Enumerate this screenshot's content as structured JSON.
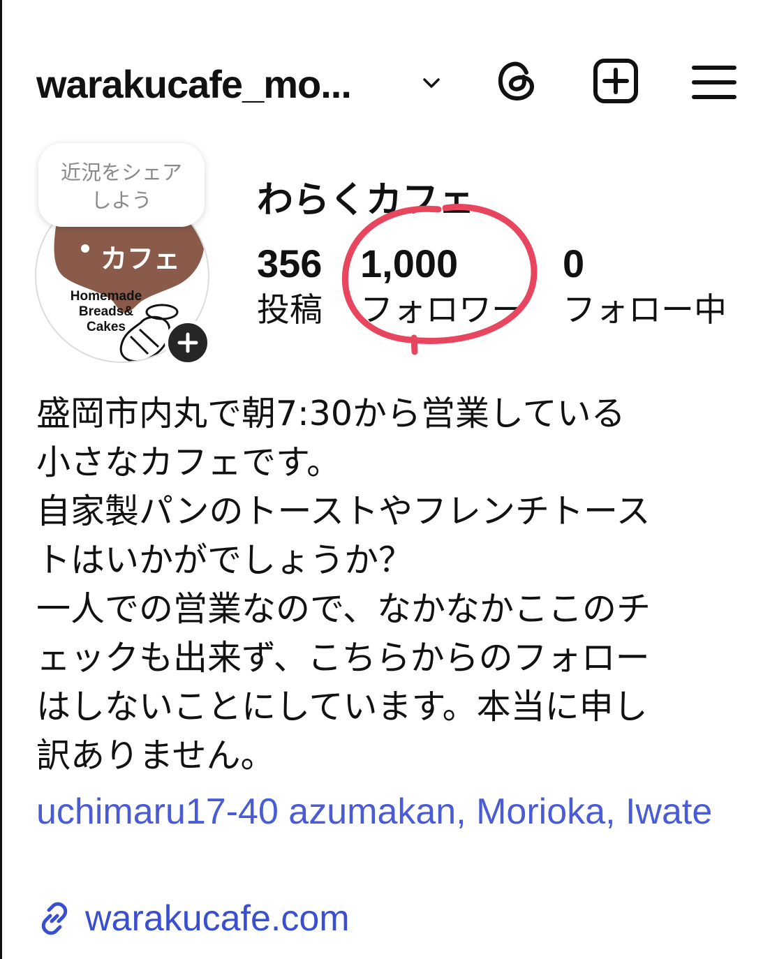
{
  "header": {
    "username": "warakucafe_mo...",
    "icons": [
      "chevron-down-icon",
      "threads-icon",
      "create-icon",
      "menu-icon"
    ]
  },
  "note": {
    "text_line1": "近況をシェア",
    "text_line2": "しよう"
  },
  "avatar": {
    "logo_text_jp": "わらく カフェ",
    "logo_text_line1": "Homemade",
    "logo_text_line2": "Breads&",
    "logo_text_line3": "Cakes"
  },
  "profile": {
    "display_name": "わらくカフェ",
    "stats": {
      "posts_count": "356",
      "posts_label": "投稿",
      "followers_count": "1,000",
      "followers_label": "フォロワー",
      "following_count": "0",
      "following_label": "フォロー中"
    },
    "bio": "盛岡市内丸で朝7:30から営業している\n小さなカフェです。\n自家製パンのトーストやフレンチトース\nトはいかがでしょうか？\n一人での営業なので、なかなかここのチ\nェックも出来ず、こちらからのフォロー\nはしないことにしています。本当に申し\n訳ありません。",
    "address": "uchimaru17-40 azumakan, Morioka, Iwate",
    "website": "warakucafe.com"
  },
  "colors": {
    "text": "#111111",
    "link": "#4a5bd6",
    "annotation": "#e8455f",
    "logo_brown": "#8a5a4a"
  }
}
